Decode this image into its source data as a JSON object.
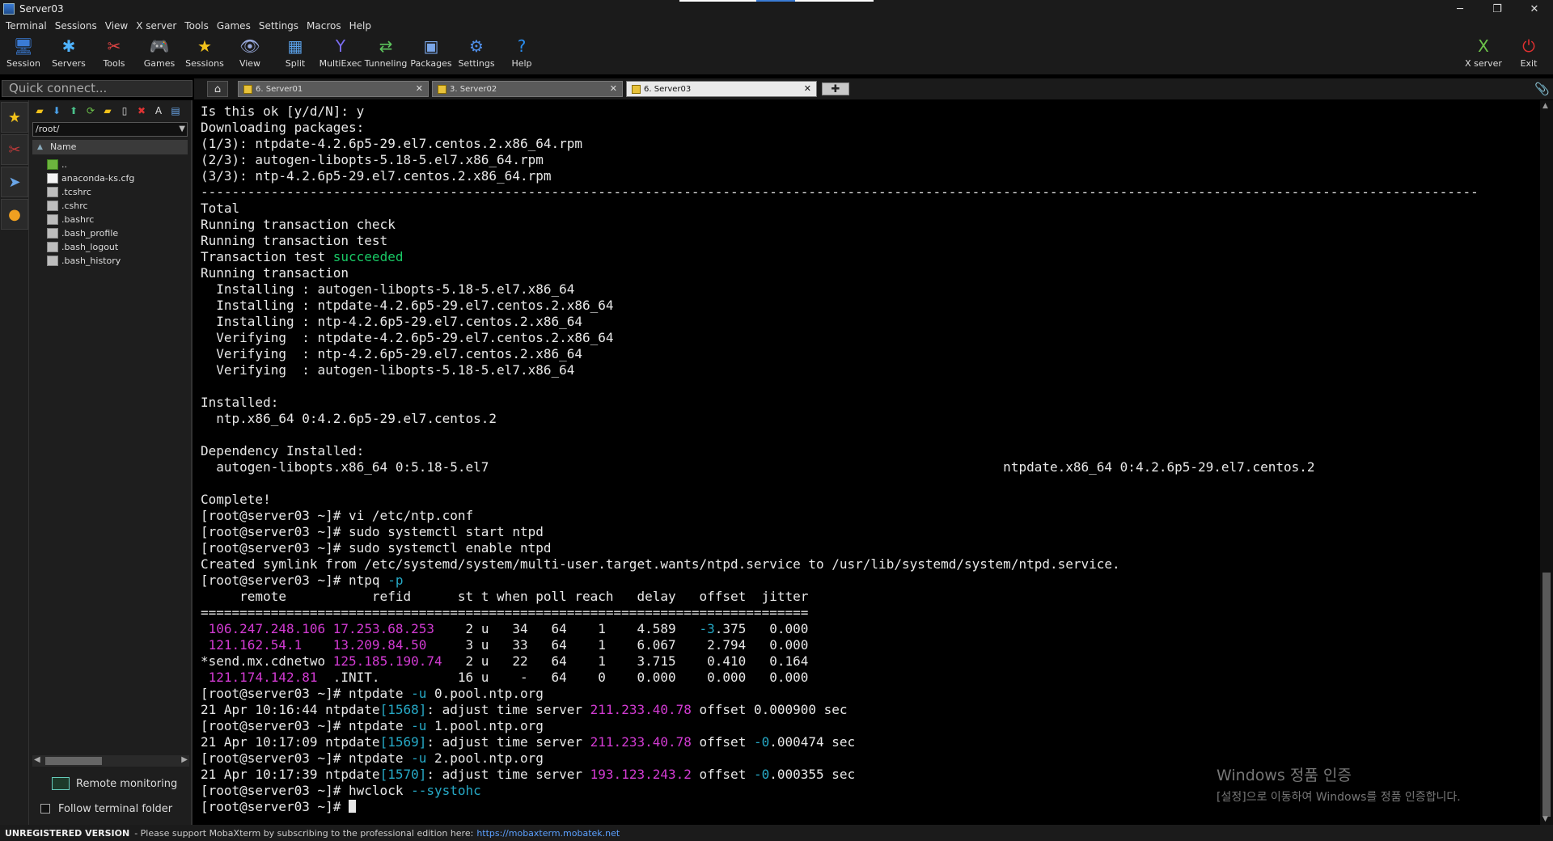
{
  "window": {
    "title": "Server03",
    "minimize": "─",
    "restore": "❐",
    "close": "✕"
  },
  "menu": [
    "Terminal",
    "Sessions",
    "View",
    "X server",
    "Tools",
    "Games",
    "Settings",
    "Macros",
    "Help"
  ],
  "toolbar": {
    "left": [
      {
        "label": "Session",
        "icon": "session-icon",
        "glyph": "🖥",
        "color": "#3a7bd5"
      },
      {
        "label": "Servers",
        "icon": "servers-icon",
        "glyph": "✱",
        "color": "#4fb3ff"
      },
      {
        "label": "Tools",
        "icon": "tools-icon",
        "glyph": "✂",
        "color": "#e04444"
      },
      {
        "label": "Games",
        "icon": "games-icon",
        "glyph": "🎮",
        "color": "#dddddd"
      },
      {
        "label": "Sessions",
        "icon": "star-icon",
        "glyph": "★",
        "color": "#f2c21b"
      },
      {
        "label": "View",
        "icon": "view-icon",
        "glyph": "👁",
        "color": "#9ad"
      },
      {
        "label": "Split",
        "icon": "split-icon",
        "glyph": "▦",
        "color": "#5aa0e8"
      },
      {
        "label": "MultiExec",
        "icon": "multiexec-icon",
        "glyph": "Y",
        "color": "#7a6cf0"
      },
      {
        "label": "Tunneling",
        "icon": "tunneling-icon",
        "glyph": "⇄",
        "color": "#5cc35c"
      },
      {
        "label": "Packages",
        "icon": "packages-icon",
        "glyph": "▣",
        "color": "#7aa6e8"
      },
      {
        "label": "Settings",
        "icon": "gear-icon",
        "glyph": "⚙",
        "color": "#4f8ee8"
      },
      {
        "label": "Help",
        "icon": "help-icon",
        "glyph": "?",
        "color": "#2a8ef0"
      }
    ],
    "right": [
      {
        "label": "X server",
        "icon": "xserver-icon",
        "glyph": "X",
        "color": "#6cc24a"
      },
      {
        "label": "Exit",
        "icon": "power-icon",
        "glyph": "⏻",
        "color": "#e03030"
      }
    ]
  },
  "quick_connect": {
    "placeholder": "Quick connect..."
  },
  "tabs": [
    {
      "label": "6. Server01",
      "active": false
    },
    {
      "label": "3. Server02",
      "active": false
    },
    {
      "label": "6. Server03",
      "active": true
    }
  ],
  "file_browser": {
    "path": "/root/",
    "header": "Name",
    "items": [
      {
        "name": "..",
        "kind": "up"
      },
      {
        "name": "anaconda-ks.cfg",
        "kind": "doc"
      },
      {
        "name": ".tcshrc",
        "kind": "file"
      },
      {
        "name": ".cshrc",
        "kind": "file"
      },
      {
        "name": ".bashrc",
        "kind": "file"
      },
      {
        "name": ".bash_profile",
        "kind": "file"
      },
      {
        "name": ".bash_logout",
        "kind": "file"
      },
      {
        "name": ".bash_history",
        "kind": "file"
      }
    ],
    "remote_monitoring": "Remote monitoring",
    "follow_terminal_folder": "Follow terminal folder"
  },
  "terminal_lines": [
    [
      {
        "t": "Is this ok [y/d/N]: y"
      }
    ],
    [
      {
        "t": "Downloading packages:"
      }
    ],
    [
      {
        "t": "(1/3): ntpdate-4.2.6p5-29.el7.centos.2.x86_64.rpm"
      }
    ],
    [
      {
        "t": "(2/3): autogen-libopts-5.18-5.el7.x86_64.rpm"
      }
    ],
    [
      {
        "t": "(3/3): ntp-4.2.6p5-29.el7.centos.2.x86_64.rpm"
      }
    ],
    [
      {
        "t": "--------------------------------------------------------------------------------------------------------------------------------------------------------------------"
      }
    ],
    [
      {
        "t": "Total"
      }
    ],
    [
      {
        "t": "Running transaction check"
      }
    ],
    [
      {
        "t": "Running transaction test"
      }
    ],
    [
      {
        "t": "Transaction test "
      },
      {
        "t": "succeeded",
        "c": "green"
      }
    ],
    [
      {
        "t": "Running transaction"
      }
    ],
    [
      {
        "t": "  Installing : autogen-libopts-5.18-5.el7.x86_64"
      }
    ],
    [
      {
        "t": "  Installing : ntpdate-4.2.6p5-29.el7.centos.2.x86_64"
      }
    ],
    [
      {
        "t": "  Installing : ntp-4.2.6p5-29.el7.centos.2.x86_64"
      }
    ],
    [
      {
        "t": "  Verifying  : ntpdate-4.2.6p5-29.el7.centos.2.x86_64"
      }
    ],
    [
      {
        "t": "  Verifying  : ntp-4.2.6p5-29.el7.centos.2.x86_64"
      }
    ],
    [
      {
        "t": "  Verifying  : autogen-libopts-5.18-5.el7.x86_64"
      }
    ],
    [
      {
        "t": ""
      }
    ],
    [
      {
        "t": "Installed:"
      }
    ],
    [
      {
        "t": "  ntp.x86_64 0:4.2.6p5-29.el7.centos.2"
      }
    ],
    [
      {
        "t": ""
      }
    ],
    [
      {
        "t": "Dependency Installed:"
      }
    ],
    [
      {
        "t": "  autogen-libopts.x86_64 0:5.18-5.el7                                                                  ntpdate.x86_64 0:4.2.6p5-29.el7.centos.2"
      }
    ],
    [
      {
        "t": ""
      }
    ],
    [
      {
        "t": "Complete!"
      }
    ],
    [
      {
        "t": "[root@server03 ~]# vi /etc/ntp.conf"
      }
    ],
    [
      {
        "t": "[root@server03 ~]# sudo systemctl start ntpd"
      }
    ],
    [
      {
        "t": "[root@server03 ~]# sudo systemctl enable ntpd"
      }
    ],
    [
      {
        "t": "Created symlink from /etc/systemd/system/multi-user.target.wants/ntpd.service to /usr/lib/systemd/system/ntpd.service."
      }
    ],
    [
      {
        "t": "[root@server03 ~]# ntpq "
      },
      {
        "t": "-p",
        "c": "cyan"
      }
    ],
    [
      {
        "t": "     remote           refid      st t when poll reach   delay   offset  jitter"
      }
    ],
    [
      {
        "t": "=============================================================================="
      }
    ],
    [
      {
        "t": " "
      },
      {
        "t": "106.247.248.106",
        "c": "magenta"
      },
      {
        "t": " "
      },
      {
        "t": "17.253.68.253",
        "c": "magenta"
      },
      {
        "t": "    2 u   34   64    1    4.589   "
      },
      {
        "t": "-3",
        "c": "cyan"
      },
      {
        "t": ".375   0.000"
      }
    ],
    [
      {
        "t": " "
      },
      {
        "t": "121.162.54.1",
        "c": "magenta"
      },
      {
        "t": "    "
      },
      {
        "t": "13.209.84.50",
        "c": "magenta"
      },
      {
        "t": "     3 u   33   64    1    6.067    2.794   0.000"
      }
    ],
    [
      {
        "t": "*send.mx.cdnetwo "
      },
      {
        "t": "125.185.190.74",
        "c": "magenta"
      },
      {
        "t": "   2 u   22   64    1    3.715    0.410   0.164"
      }
    ],
    [
      {
        "t": " "
      },
      {
        "t": "121.174.142.81",
        "c": "magenta"
      },
      {
        "t": "  .INIT.          16 u    -   64    0    0.000    0.000   0.000"
      }
    ],
    [
      {
        "t": "[root@server03 ~]# ntpdate "
      },
      {
        "t": "-u",
        "c": "cyan"
      },
      {
        "t": " 0.pool.ntp.org"
      }
    ],
    [
      {
        "t": "21 Apr 10:16:44 ntpdate"
      },
      {
        "t": "[1568]",
        "c": "cyan"
      },
      {
        "t": ": adjust time server "
      },
      {
        "t": "211.233.40.78",
        "c": "magenta"
      },
      {
        "t": " offset 0.000900 sec"
      }
    ],
    [
      {
        "t": "[root@server03 ~]# ntpdate "
      },
      {
        "t": "-u",
        "c": "cyan"
      },
      {
        "t": " 1.pool.ntp.org"
      }
    ],
    [
      {
        "t": "21 Apr 10:17:09 ntpdate"
      },
      {
        "t": "[1569]",
        "c": "cyan"
      },
      {
        "t": ": adjust time server "
      },
      {
        "t": "211.233.40.78",
        "c": "magenta"
      },
      {
        "t": " offset "
      },
      {
        "t": "-0",
        "c": "cyan"
      },
      {
        "t": ".000474 sec"
      }
    ],
    [
      {
        "t": "[root@server03 ~]# ntpdate "
      },
      {
        "t": "-u",
        "c": "cyan"
      },
      {
        "t": " 2.pool.ntp.org"
      }
    ],
    [
      {
        "t": "21 Apr 10:17:39 ntpdate"
      },
      {
        "t": "[1570]",
        "c": "cyan"
      },
      {
        "t": ": adjust time server "
      },
      {
        "t": "193.123.243.2",
        "c": "magenta"
      },
      {
        "t": " offset "
      },
      {
        "t": "-0",
        "c": "cyan"
      },
      {
        "t": ".000355 sec"
      }
    ],
    [
      {
        "t": "[root@server03 ~]# hwclock "
      },
      {
        "t": "--systohc",
        "c": "cyan"
      }
    ],
    [
      {
        "t": "[root@server03 ~]# "
      },
      {
        "cursor": true
      }
    ]
  ],
  "watermark": {
    "title": "Windows 정품 인증",
    "subtitle": "[설정]으로 이동하여 Windows를 정품 인증합니다."
  },
  "statusbar": {
    "unregistered": "UNREGISTERED VERSION",
    "message": " -  Please support MobaXterm by subscribing to the professional edition here: ",
    "link": "https://mobaxterm.mobatek.net"
  }
}
